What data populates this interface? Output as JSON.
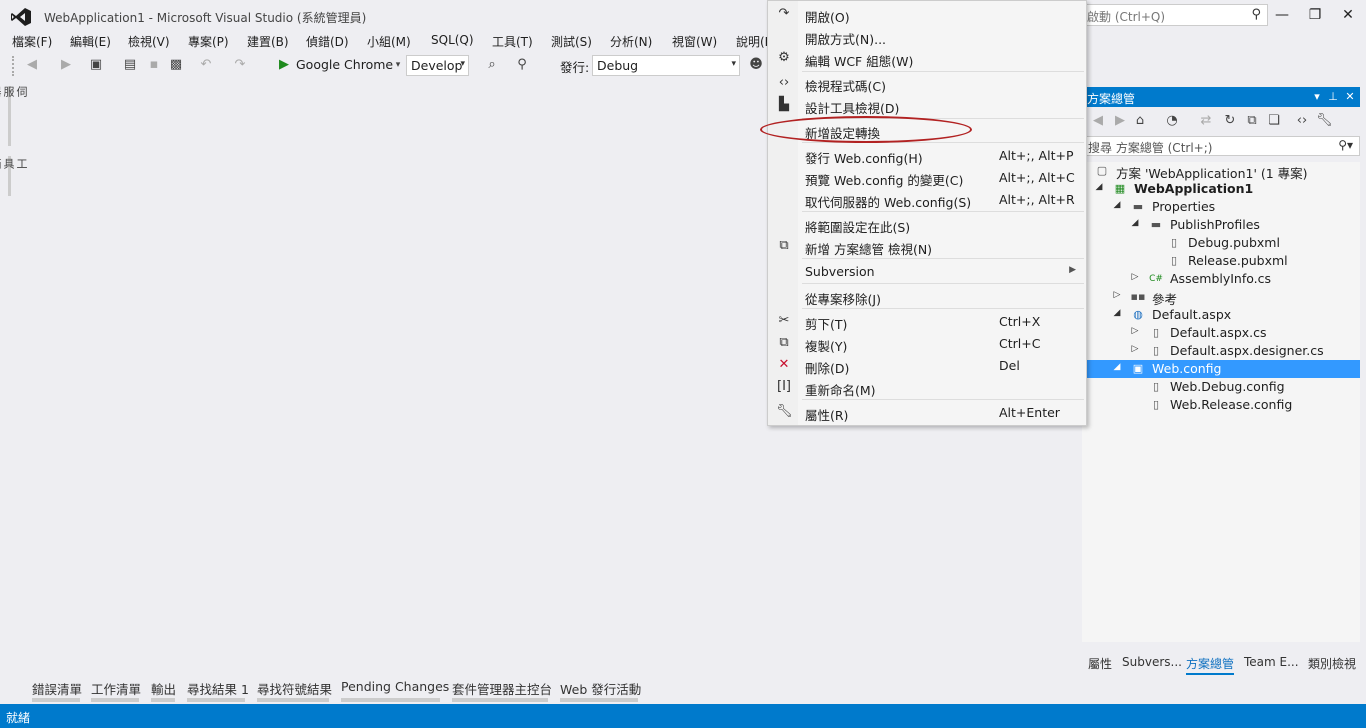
{
  "window": {
    "title": "WebApplication1 - Microsoft Visual Studio (系統管理員)",
    "quick_launch_placeholder": "啟動 (Ctrl+Q)",
    "min_icon": "minimize-icon",
    "restore_icon": "restore-icon",
    "close_icon": "close-icon"
  },
  "menu": [
    {
      "label": "檔案(F)"
    },
    {
      "label": "編輯(E)"
    },
    {
      "label": "檢視(V)"
    },
    {
      "label": "專案(P)"
    },
    {
      "label": "建置(B)"
    },
    {
      "label": "偵錯(D)"
    },
    {
      "label": "小組(M)"
    },
    {
      "label": "SQL(Q)"
    },
    {
      "label": "工具(T)"
    },
    {
      "label": "測試(S)"
    },
    {
      "label": "分析(N)"
    },
    {
      "label": "視窗(W)"
    },
    {
      "label": "說明(H)"
    }
  ],
  "toolbar": {
    "run_target": "Google Chrome",
    "config": "Develop",
    "publish_label": "發行:",
    "publish_profile": "Debug"
  },
  "side_tabs": {
    "server_explorer": "伺服器總管",
    "toolbox": "工具箱"
  },
  "context_menu": {
    "items": [
      {
        "icon": "open-icon",
        "label": "開啟(O)",
        "shortcut": ""
      },
      {
        "icon": "",
        "label": "開啟方式(N)...",
        "shortcut": ""
      },
      {
        "icon": "wcf-config-icon",
        "label": "編輯 WCF 組態(W)",
        "shortcut": ""
      },
      {
        "icon": "view-code-icon",
        "label": "檢視程式碼(C)",
        "shortcut": ""
      },
      {
        "icon": "designer-icon",
        "label": "設計工具檢視(D)",
        "shortcut": ""
      },
      {
        "icon": "",
        "label": "新增設定轉換",
        "shortcut": ""
      },
      {
        "icon": "",
        "label": "發行 Web.config(H)",
        "shortcut": "Alt+;, Alt+P"
      },
      {
        "icon": "",
        "label": "預覽 Web.config 的變更(C)",
        "shortcut": "Alt+;, Alt+C"
      },
      {
        "icon": "",
        "label": "取代伺服器的 Web.config(S)",
        "shortcut": "Alt+;, Alt+R"
      },
      {
        "icon": "",
        "label": "將範圍設定在此(S)",
        "shortcut": ""
      },
      {
        "icon": "new-view-icon",
        "label": "新增 方案總管 檢視(N)",
        "shortcut": ""
      },
      {
        "icon": "",
        "label": "Subversion",
        "shortcut": ""
      },
      {
        "icon": "",
        "label": "從專案移除(J)",
        "shortcut": ""
      },
      {
        "icon": "cut-icon",
        "label": "剪下(T)",
        "shortcut": "Ctrl+X"
      },
      {
        "icon": "copy-icon",
        "label": "複製(Y)",
        "shortcut": "Ctrl+C"
      },
      {
        "icon": "delete-icon",
        "label": "刪除(D)",
        "shortcut": "Del"
      },
      {
        "icon": "rename-icon",
        "label": "重新命名(M)",
        "shortcut": ""
      },
      {
        "icon": "properties-icon",
        "label": "屬性(R)",
        "shortcut": "Alt+Enter"
      }
    ],
    "accent": "#b22222"
  },
  "solution_explorer": {
    "title": "方案總管",
    "search_placeholder": "搜尋 方案總管 (Ctrl+;)",
    "tree": [
      {
        "label": "方案 'WebApplication1' (1 專案)",
        "icon": "solution-icon"
      },
      {
        "label": "WebApplication1",
        "icon": "web-project-icon"
      },
      {
        "label": "Properties",
        "icon": "folder-icon"
      },
      {
        "label": "PublishProfiles",
        "icon": "folder-icon"
      },
      {
        "label": "Debug.pubxml",
        "icon": "file-icon"
      },
      {
        "label": "Release.pubxml",
        "icon": "file-icon"
      },
      {
        "label": "AssemblyInfo.cs",
        "icon": "csharp-icon"
      },
      {
        "label": "參考",
        "icon": "references-icon"
      },
      {
        "label": "Default.aspx",
        "icon": "aspx-icon"
      },
      {
        "label": "Default.aspx.cs",
        "icon": "cs-file-icon"
      },
      {
        "label": "Default.aspx.designer.cs",
        "icon": "cs-file-icon"
      },
      {
        "label": "Web.config",
        "icon": "config-icon"
      },
      {
        "label": "Web.Debug.config",
        "icon": "config-file-icon"
      },
      {
        "label": "Web.Release.config",
        "icon": "config-file-icon"
      }
    ],
    "tabs": [
      {
        "label": "屬性"
      },
      {
        "label": "Subvers..."
      },
      {
        "label": "方案總管"
      },
      {
        "label": "Team E..."
      },
      {
        "label": "類別檢視"
      }
    ],
    "accent": "#007acc"
  },
  "bottom_tabs": [
    {
      "label": "錯誤清單"
    },
    {
      "label": "工作清單"
    },
    {
      "label": "輸出"
    },
    {
      "label": "尋找結果 1"
    },
    {
      "label": "尋找符號結果"
    },
    {
      "label": "Pending Changes"
    },
    {
      "label": "套件管理器主控台"
    },
    {
      "label": "Web 發行活動"
    }
  ],
  "status": {
    "text": "就緒"
  }
}
